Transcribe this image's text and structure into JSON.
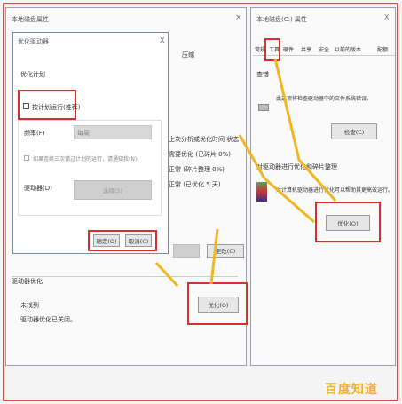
{
  "accent": "#d62f2f",
  "arrow_color": "#f2b623",
  "left_window": {
    "title": "本地磁盘属性",
    "close_icon": "close-icon",
    "compress_label": "压缩",
    "bottom_section": "驱动器优化",
    "bottom_sub": "未找到",
    "bottom_desc": "驱动器优化已关闭。",
    "bottom_btn1": "",
    "bottom_btn2": "更改(C)",
    "optimize_btn": "优化(O)"
  },
  "dialog": {
    "title": "优化驱动器",
    "close_label": "X",
    "section_label": "优化计划",
    "checkbox_label": "按计划运行(推荐)",
    "freq_label": "频率(F)",
    "freq_value": "每周",
    "notify_label": "如果连续三次错过计划的运行，请通知我(N)",
    "drives_label": "驱动器(D)",
    "choose_btn": "选择(S)",
    "ok_btn": "确定(O)",
    "cancel_btn": "取消(C)"
  },
  "right_window": {
    "title": "本地磁盘(C:) 属性",
    "close_label": "X",
    "tabs": [
      "常规",
      "工具",
      "硬件",
      "共享",
      "安全",
      "以前的版本",
      "配额"
    ],
    "active_tab": 1,
    "check_section": "查错",
    "check_desc": "此选项将检查驱动器中的文件系统错误。",
    "check_btn": "检查(C)",
    "optimize_section": "对驱动器进行优化和碎片整理",
    "optimize_desc": "对计算机驱动器进行优化可以帮助其更高效运行。",
    "optimize_btn": "优化(O)"
  },
  "middle_labels": [
    "上次分析或优化时间 状态",
    "需要优化 (已碎片 0%)",
    "正常 (碎片整理 0%)",
    "正常 (已优化 5 天)"
  ],
  "watermark": "百度知道"
}
